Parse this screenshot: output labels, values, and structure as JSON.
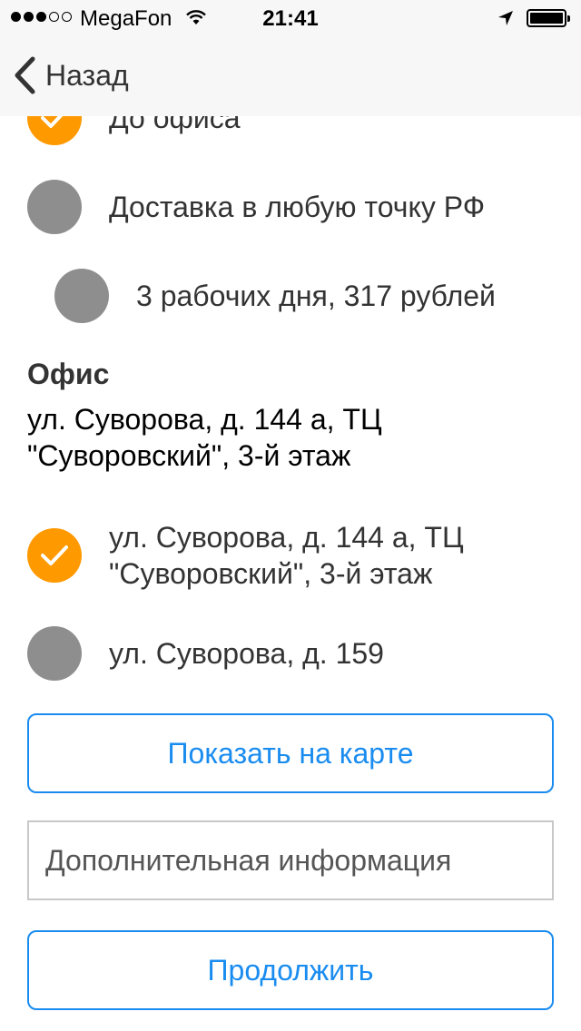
{
  "status_bar": {
    "carrier": "MegaFon",
    "time": "21:41"
  },
  "nav": {
    "back_label": "Назад"
  },
  "delivery_options": [
    {
      "label": "До офиса",
      "checked": true
    },
    {
      "label": "Доставка в любую точку РФ",
      "checked": false
    },
    {
      "label": "3 рабочих дня, 317 рублей",
      "checked": false
    }
  ],
  "office": {
    "title": "Офис",
    "value": "ул. Суворова, д. 144 а, ТЦ \"Суворовский\", 3-й этаж"
  },
  "office_options": [
    {
      "label": "ул. Суворова, д. 144 а, ТЦ \"Суворовский\", 3-й этаж",
      "checked": true
    },
    {
      "label": "ул. Суворова, д. 159",
      "checked": false
    }
  ],
  "buttons": {
    "show_on_map": "Показать на карте",
    "continue": "Продолжить"
  },
  "info_field": {
    "placeholder": "Дополнительная информация"
  },
  "colors": {
    "accent": "#1a8cf0",
    "checked": "#ff9900",
    "unchecked": "#8e8e8e"
  }
}
